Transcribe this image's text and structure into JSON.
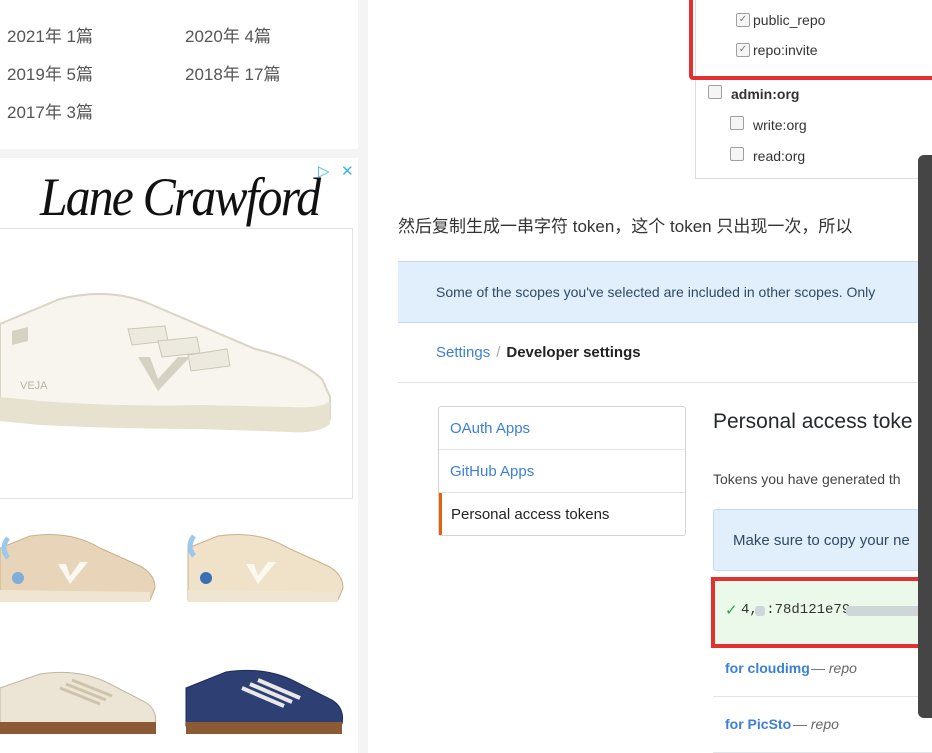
{
  "archive": {
    "items": [
      {
        "label": "2021年 1篇"
      },
      {
        "label": "2020年 4篇"
      },
      {
        "label": "2019年 5篇"
      },
      {
        "label": "2018年 17篇"
      },
      {
        "label": "2017年 3篇"
      }
    ]
  },
  "ad": {
    "brand": "Lane Crawford",
    "adchoices_icon": "play-triangle",
    "close_icon": "x",
    "shoe_brand_text": "VEJA"
  },
  "scopes": {
    "items": [
      {
        "label": "public_repo",
        "checked": true
      },
      {
        "label": "repo:invite",
        "checked": true
      },
      {
        "label": "admin:org",
        "checked": false
      },
      {
        "label": "write:org",
        "checked": false
      },
      {
        "label": "read:org",
        "checked": false
      }
    ]
  },
  "article": {
    "paragraph": "然后复制生成一串字符 token，这个 token 只出现一次，所以"
  },
  "github": {
    "flash": "Some of the scopes you've selected are included in other scopes. Only",
    "breadcrumb": {
      "link": "Settings",
      "separator": "/",
      "current": "Developer settings"
    },
    "menu": [
      "OAuth Apps",
      "GitHub Apps",
      "Personal access tokens"
    ],
    "title": "Personal access toke",
    "subtitle": "Tokens you have generated th",
    "notice": "Make sure to copy your ne",
    "token": {
      "check": "✓",
      "visible": "4,  :78d121e79"
    },
    "tokens": [
      {
        "name": "for cloudimg",
        "dash": " — ",
        "scope": "repo"
      },
      {
        "name": "for PicSto",
        "dash": " — ",
        "scope": "repo"
      }
    ]
  },
  "colors": {
    "link": "#3c7fd8",
    "highlight_red": "#e53030",
    "flash_bg": "#e1eefb",
    "success_bg": "#eaf9e9",
    "active_tab": "#e36209"
  }
}
